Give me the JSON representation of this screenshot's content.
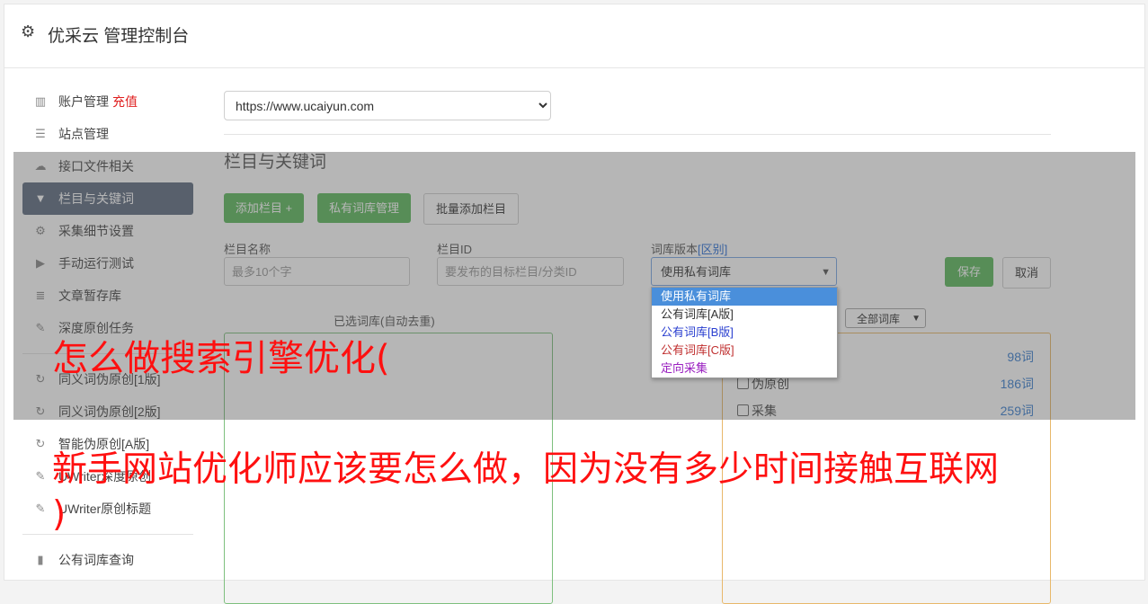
{
  "header": {
    "title": "优采云 管理控制台",
    "icon": "gear-icon"
  },
  "sidebar": {
    "items": [
      {
        "label": "账户管理",
        "tag": "充值",
        "icon": "bar-chart-icon",
        "active": false
      },
      {
        "label": "站点管理",
        "icon": "server-icon",
        "active": false
      },
      {
        "label": "接口文件相关",
        "icon": "cloud-upload-icon",
        "active": false
      },
      {
        "label": "栏目与关键词",
        "icon": "filter-icon",
        "active": true
      },
      {
        "label": "采集细节设置",
        "icon": "gears-icon",
        "active": false
      },
      {
        "label": "手动运行测试",
        "icon": "play-circle-icon",
        "active": false
      },
      {
        "label": "文章暂存库",
        "icon": "database-icon",
        "active": false
      },
      {
        "label": "深度原创任务",
        "icon": "edit-icon",
        "active": false
      }
    ],
    "items2": [
      {
        "label": "同义词伪原创[1版]",
        "icon": "refresh-icon"
      },
      {
        "label": "同义词伪原创[2版]",
        "icon": "refresh-icon"
      },
      {
        "label": "智能伪原创[A版]",
        "icon": "refresh-icon"
      },
      {
        "label": "UWriter深度原创",
        "icon": "edit-icon"
      },
      {
        "label": "UWriter原创标题",
        "icon": "edit-icon"
      }
    ],
    "items3": [
      {
        "label": "公有词库查询",
        "icon": "book-icon"
      }
    ]
  },
  "main": {
    "site_select": "https://www.ucaiyun.com",
    "section_title": "栏目与关键词",
    "buttons": {
      "add_column": "添加栏目 +",
      "private_lib": "私有词库管理",
      "batch_add": "批量添加栏目"
    },
    "form": {
      "name_label": "栏目名称",
      "name_placeholder": "最多10个字",
      "id_label": "栏目ID",
      "id_placeholder": "要发布的目标栏目/分类ID",
      "lib_label": "词库版本",
      "lib_diff": "[区别]",
      "lib_value": "使用私有词库",
      "save": "保存",
      "cancel": "取消"
    },
    "dropdown_options": [
      {
        "label": "使用私有词库",
        "color": "#ffffff",
        "selected": true
      },
      {
        "label": "公有词库[A版]",
        "color": "#333333"
      },
      {
        "label": "公有词库[B版]",
        "color": "#2a3fd0"
      },
      {
        "label": "公有词库[C版]",
        "color": "#c03030"
      },
      {
        "label": "定向采集",
        "color": "#9a20c0"
      }
    ],
    "selected_caption": "已选词库(自动去重)",
    "filter_select": "全部词库",
    "libraries": [
      {
        "name": "",
        "count": "98词"
      },
      {
        "name": "伪原创",
        "count": "186词"
      },
      {
        "name": "采集",
        "count": "259词"
      }
    ]
  },
  "overlay_text": {
    "line1": "怎么做搜索引擎优化(",
    "line2": "新手网站优化师应该要怎么做，因为没有多少时间接触互联网",
    "line3": ")"
  }
}
